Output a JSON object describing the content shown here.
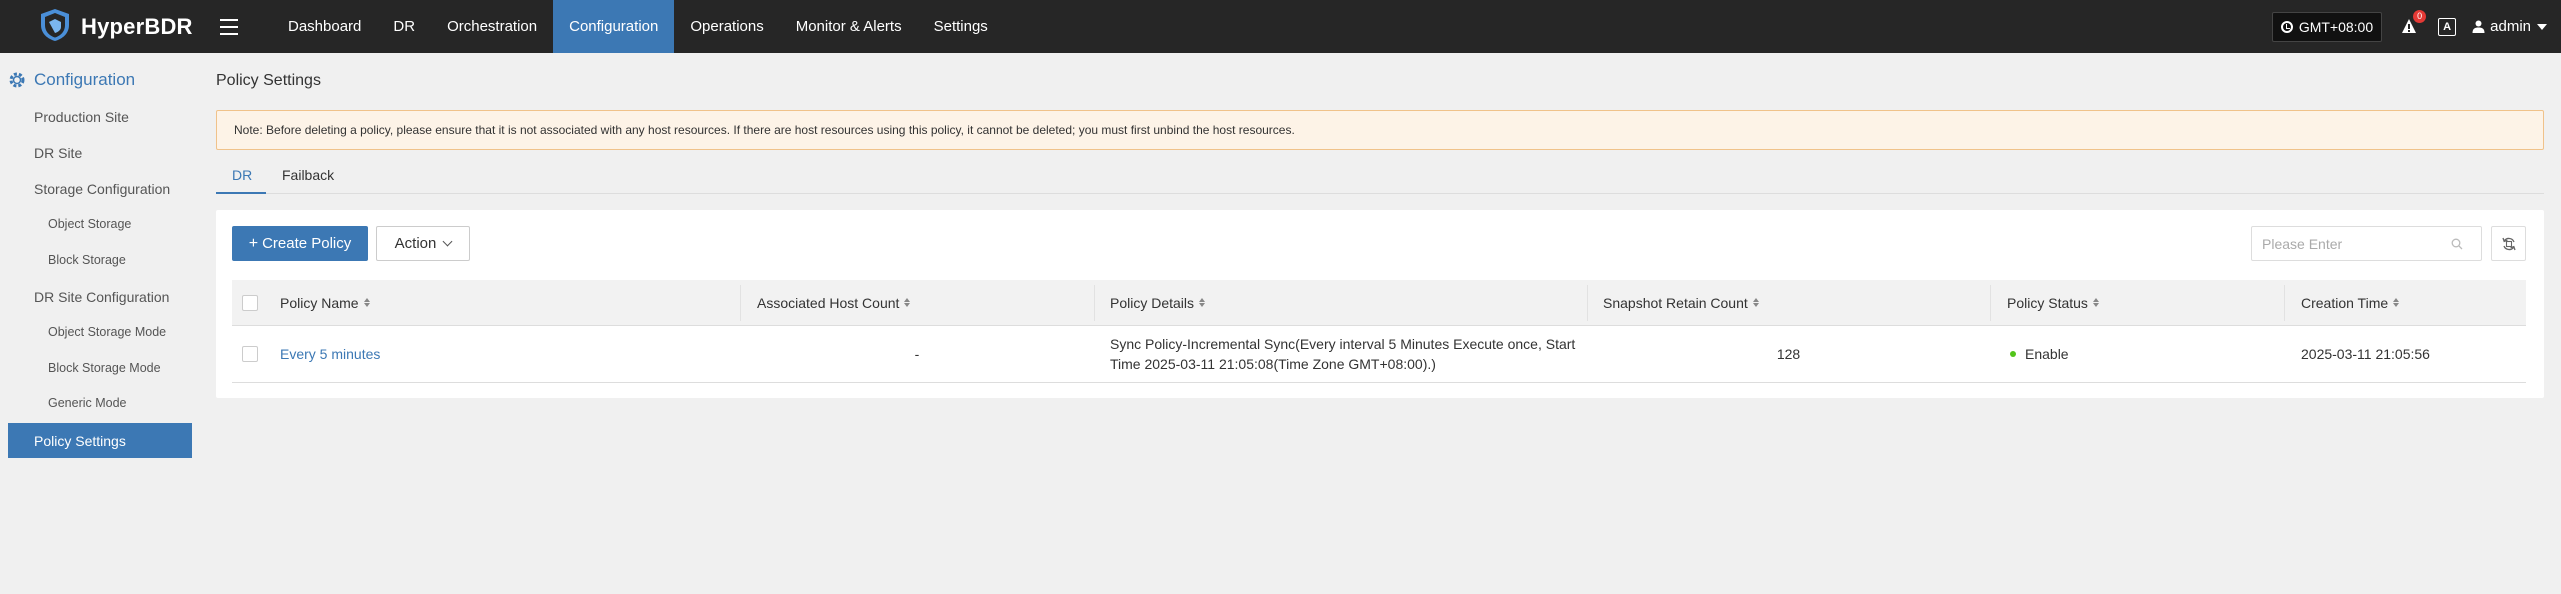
{
  "brand": {
    "name": "HyperBDR"
  },
  "nav": {
    "items": [
      "Dashboard",
      "DR",
      "Orchestration",
      "Configuration",
      "Operations",
      "Monitor & Alerts",
      "Settings"
    ],
    "active": "Configuration"
  },
  "topbar": {
    "timezone": "GMT+08:00",
    "alert_count": "0",
    "language_icon": "A",
    "user": "admin"
  },
  "sidebar": {
    "title": "Configuration",
    "items": [
      {
        "label": "Production Site",
        "level": 1
      },
      {
        "label": "DR Site",
        "level": 1
      },
      {
        "label": "Storage Configuration",
        "level": 1
      },
      {
        "label": "Object Storage",
        "level": 2
      },
      {
        "label": "Block Storage",
        "level": 2
      },
      {
        "label": "DR Site Configuration",
        "level": 1
      },
      {
        "label": "Object Storage Mode",
        "level": 2
      },
      {
        "label": "Block Storage Mode",
        "level": 2
      },
      {
        "label": "Generic Mode",
        "level": 2
      }
    ],
    "active": "Policy Settings"
  },
  "page": {
    "title": "Policy Settings",
    "notice": "Note: Before deleting a policy, please ensure that it is not associated with any host resources. If there are host resources using this policy, it cannot be deleted; you must first unbind the host resources.",
    "tabs": [
      "DR",
      "Failback"
    ],
    "active_tab": "DR"
  },
  "toolbar": {
    "create_label": "Create Policy",
    "action_label": "Action",
    "search_placeholder": "Please Enter"
  },
  "table": {
    "columns": [
      "Policy Name",
      "Associated Host Count",
      "Policy Details",
      "Snapshot Retain Count",
      "Policy Status",
      "Creation Time"
    ],
    "rows": [
      {
        "name": "Every 5 minutes",
        "host_count": "-",
        "details": "Sync Policy-Incremental Sync(Every interval 5 Minutes Execute once, Start Time 2025-03-11 21:05:08(Time Zone GMT+08:00).)",
        "snapshot_retain": "128",
        "status": "Enable",
        "created": "2025-03-11 21:05:56"
      }
    ]
  },
  "colors": {
    "accent": "#3c78b4",
    "topbar": "#262626",
    "enabled": "#52c41a",
    "notice_bg": "#fdf3e7",
    "notice_border": "#f0c28a"
  },
  "icons": [
    "logo-shield-icon",
    "hamburger-icon",
    "clock-icon",
    "bell-icon",
    "language-icon",
    "user-icon",
    "caret-down-icon",
    "gear-icon",
    "plus-icon",
    "chevron-down-icon",
    "search-icon",
    "refresh-icon",
    "sort-icon"
  ]
}
